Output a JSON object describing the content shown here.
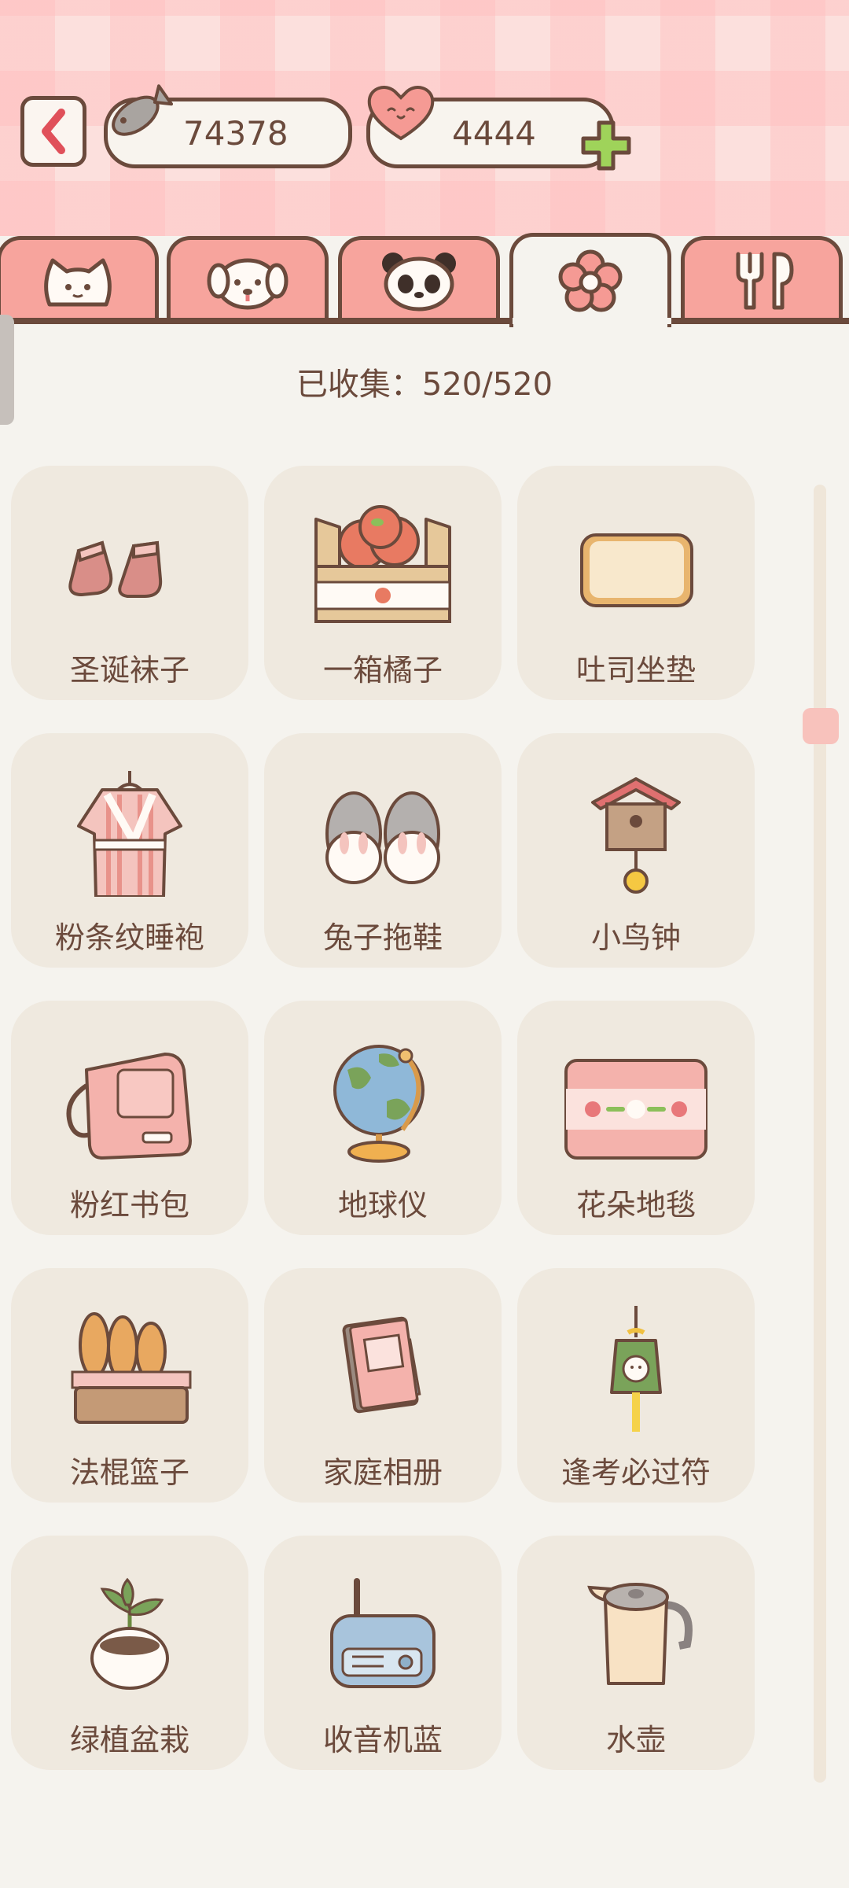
{
  "header": {
    "fish_count": "74378",
    "heart_count": "4444"
  },
  "tabs": [
    {
      "name": "cat",
      "active": false
    },
    {
      "name": "dog",
      "active": false
    },
    {
      "name": "panda",
      "active": false
    },
    {
      "name": "flower",
      "active": true
    },
    {
      "name": "food",
      "active": false
    }
  ],
  "collection": {
    "collected_text": "已收集：520/520"
  },
  "items": [
    {
      "label": "圣诞袜子",
      "icon": "socks-icon"
    },
    {
      "label": "一箱橘子",
      "icon": "orange-box-icon"
    },
    {
      "label": "吐司坐垫",
      "icon": "toast-cushion-icon"
    },
    {
      "label": "粉条纹睡袍",
      "icon": "robe-icon"
    },
    {
      "label": "兔子拖鞋",
      "icon": "bunny-slippers-icon"
    },
    {
      "label": "小鸟钟",
      "icon": "bird-clock-icon"
    },
    {
      "label": "粉红书包",
      "icon": "backpack-icon"
    },
    {
      "label": "地球仪",
      "icon": "globe-icon"
    },
    {
      "label": "花朵地毯",
      "icon": "flower-rug-icon"
    },
    {
      "label": "法棍篮子",
      "icon": "baguette-basket-icon"
    },
    {
      "label": "家庭相册",
      "icon": "photo-album-icon"
    },
    {
      "label": "逢考必过符",
      "icon": "charm-icon"
    },
    {
      "label": "绿植盆栽",
      "icon": "plant-pot-icon"
    },
    {
      "label": "收音机蓝",
      "icon": "radio-icon"
    },
    {
      "label": "水壶",
      "icon": "kettle-icon"
    }
  ],
  "colors": {
    "outline": "#6b4a3c",
    "tab_pink": "#f7a49d",
    "card_bg": "#efe9df",
    "page_bg": "#f5f3ee",
    "plus_green": "#9fd35a"
  }
}
